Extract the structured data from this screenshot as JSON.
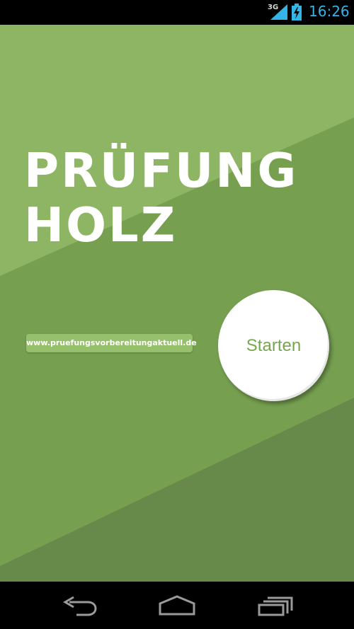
{
  "status_bar": {
    "network_type": "3G",
    "time": "16:26",
    "icons": [
      "signal-icon",
      "battery-charging-icon"
    ]
  },
  "app": {
    "title_line1": "PRÜFUNG",
    "title_line2": "HOLZ",
    "url_text": "www.pruefungsvorbereitungaktuell.de",
    "start_label": "Starten",
    "colors": {
      "background_light": "#8db563",
      "background_mid": "#76a050",
      "background_dark": "#678a4a",
      "title_text": "#ffffff",
      "start_label": "#78a64f"
    }
  },
  "nav_bar": {
    "icons": [
      "back-icon",
      "home-icon",
      "recent-apps-icon"
    ]
  }
}
